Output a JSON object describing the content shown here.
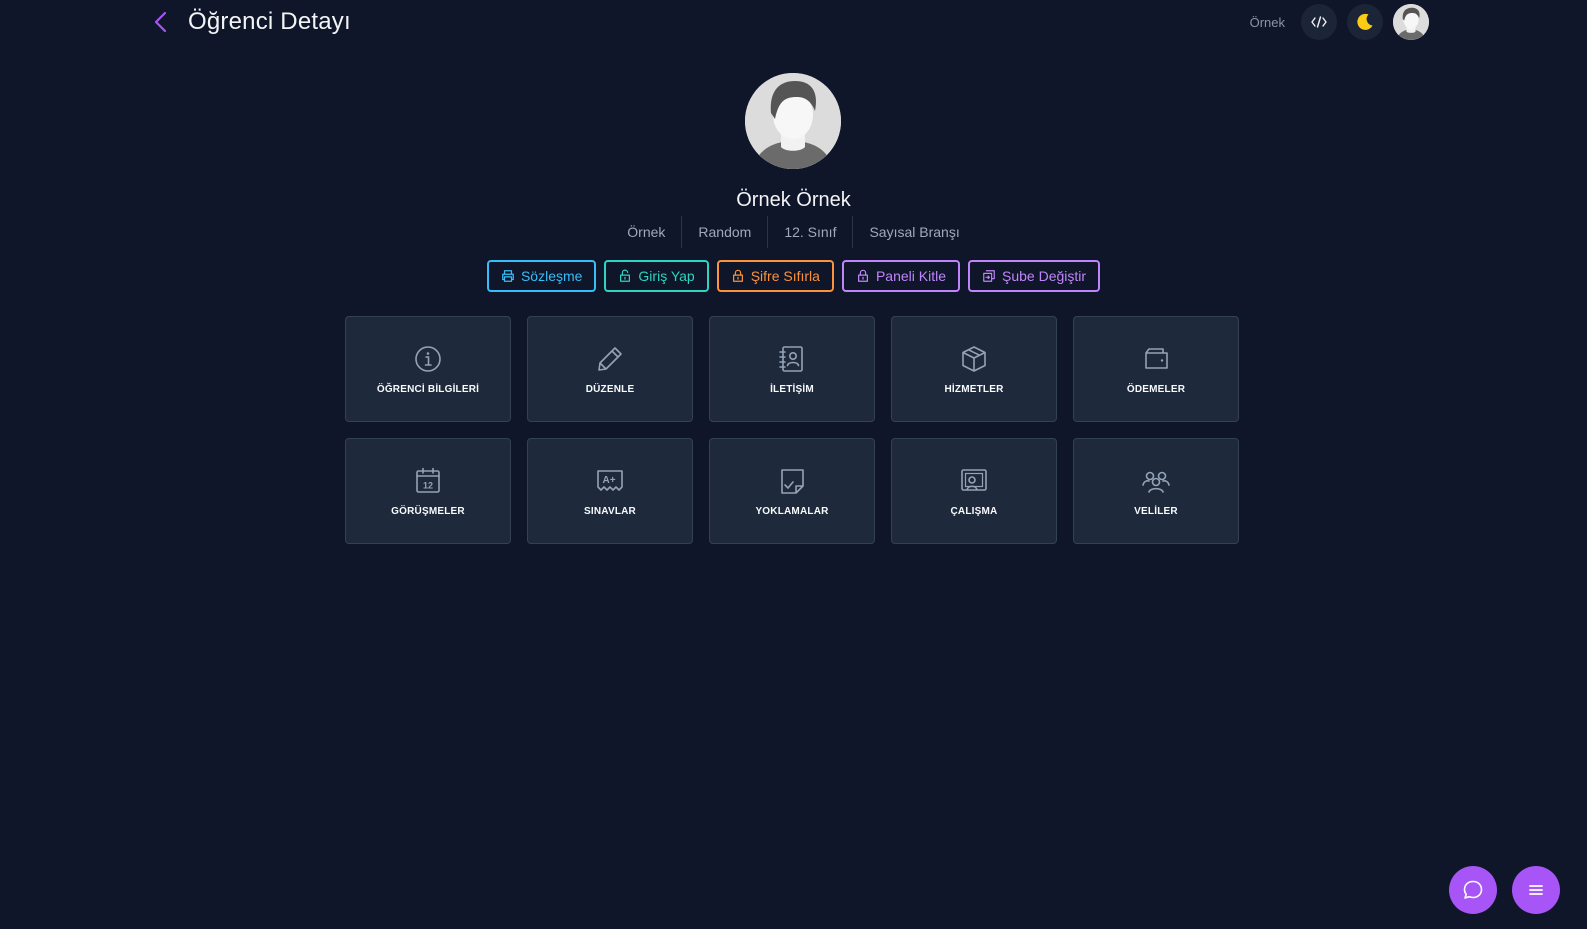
{
  "header": {
    "title": "Öğrenci Detayı",
    "user_label": "Örnek"
  },
  "profile": {
    "name": "Örnek Örnek",
    "meta": [
      "Örnek",
      "Random",
      "12. Sınıf",
      "Sayısal Branşı"
    ]
  },
  "actions": [
    {
      "label": "Sözleşme",
      "color": "#38bdf8",
      "icon": "printer-icon"
    },
    {
      "label": "Giriş Yap",
      "color": "#2dd4bf",
      "icon": "unlock-icon"
    },
    {
      "label": "Şifre Sıfırla",
      "color": "#fb923c",
      "icon": "lock-icon"
    },
    {
      "label": "Paneli Kitle",
      "color": "#c084fc",
      "icon": "lock-icon"
    },
    {
      "label": "Şube Değiştir",
      "color": "#c084fc",
      "icon": "switch-icon"
    }
  ],
  "cards": [
    {
      "label": "ÖĞRENCİ BİLGİLERİ",
      "icon": "info-icon"
    },
    {
      "label": "DÜZENLE",
      "icon": "pencil-icon"
    },
    {
      "label": "İLETİŞİM",
      "icon": "contact-book-icon"
    },
    {
      "label": "HİZMETLER",
      "icon": "box-icon"
    },
    {
      "label": "ÖDEMELER",
      "icon": "wallet-icon"
    },
    {
      "label": "GÖRÜŞMELER",
      "icon": "calendar-icon"
    },
    {
      "label": "SINAVLAR",
      "icon": "grade-icon"
    },
    {
      "label": "YOKLAMALAR",
      "icon": "checklist-icon"
    },
    {
      "label": "ÇALIŞMA",
      "icon": "study-icon"
    },
    {
      "label": "VELİLER",
      "icon": "users-icon"
    }
  ],
  "colors": {
    "background": "#0f1629",
    "card": "#1e293b",
    "accent": "#a855f7"
  }
}
